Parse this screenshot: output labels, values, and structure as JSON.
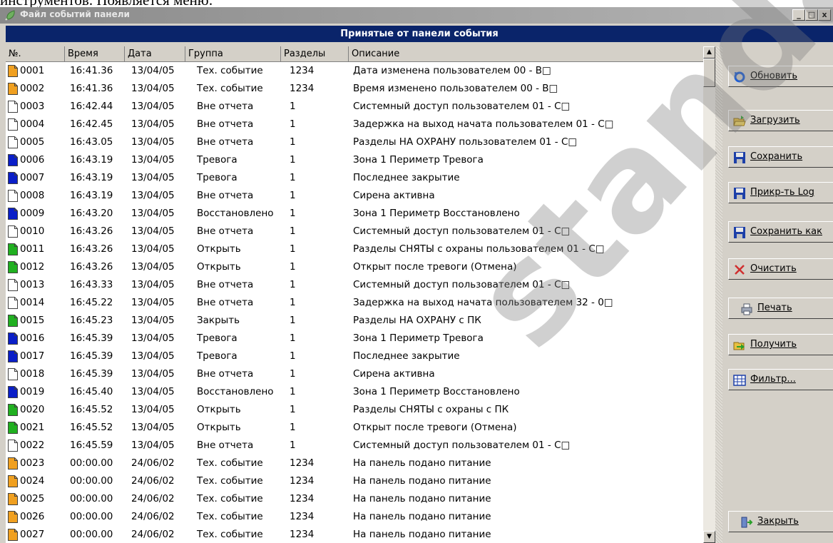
{
  "doc_caption": "инструментов. Появляется меню:",
  "window": {
    "title": "Файл событий панели",
    "minimize": "_",
    "maximize": "□",
    "close": "x"
  },
  "banner": "Принятые от панели события",
  "columns": [
    "№.",
    "Время",
    "Дата",
    "Группа",
    "Разделы",
    "Описание"
  ],
  "colors": {
    "orange": "#f0a020",
    "white": "#ffffff",
    "blue": "#0a1ec8",
    "green": "#20b020",
    "banner": "#0a246a"
  },
  "rows": [
    {
      "icon": "orange",
      "num": "0001",
      "time": "16:41.36",
      "date": "13/04/05",
      "group": "Тех. событие",
      "parts": "1234",
      "desc": "Дата изменена пользователем 00 - В□"
    },
    {
      "icon": "orange",
      "num": "0002",
      "time": "16:41.36",
      "date": "13/04/05",
      "group": "Тех. событие",
      "parts": "1234",
      "desc": "Время изменено пользователем 00 - В□"
    },
    {
      "icon": "white",
      "num": "0003",
      "time": "16:42.44",
      "date": "13/04/05",
      "group": "Вне отчета",
      "parts": "1",
      "desc": "Системный доступ пользователем 01 - С□"
    },
    {
      "icon": "white",
      "num": "0004",
      "time": "16:42.45",
      "date": "13/04/05",
      "group": "Вне отчета",
      "parts": "1",
      "desc": "Задержка на выход начата пользователем 01 - С□"
    },
    {
      "icon": "white",
      "num": "0005",
      "time": "16:43.05",
      "date": "13/04/05",
      "group": "Вне отчета",
      "parts": "1",
      "desc": "Разделы НА ОХРАНУ пользователем 01 - С□"
    },
    {
      "icon": "blue",
      "num": "0006",
      "time": "16:43.19",
      "date": "13/04/05",
      "group": "Тревога",
      "parts": "1",
      "desc": "Зона 1 Периметр Тревога"
    },
    {
      "icon": "blue",
      "num": "0007",
      "time": "16:43.19",
      "date": "13/04/05",
      "group": "Тревога",
      "parts": "1",
      "desc": "Последнее закрытие"
    },
    {
      "icon": "white",
      "num": "0008",
      "time": "16:43.19",
      "date": "13/04/05",
      "group": "Вне отчета",
      "parts": "1",
      "desc": "Сирена активна"
    },
    {
      "icon": "blue",
      "num": "0009",
      "time": "16:43.20",
      "date": "13/04/05",
      "group": "Восстановлено",
      "parts": "1",
      "desc": "Зона 1 Периметр Восстановлено"
    },
    {
      "icon": "white",
      "num": "0010",
      "time": "16:43.26",
      "date": "13/04/05",
      "group": "Вне отчета",
      "parts": "1",
      "desc": "Системный доступ пользователем 01 - С□"
    },
    {
      "icon": "green",
      "num": "0011",
      "time": "16:43.26",
      "date": "13/04/05",
      "group": "Открыть",
      "parts": "1",
      "desc": "Разделы СНЯТЫ с охраны пользователем 01 - С□"
    },
    {
      "icon": "green",
      "num": "0012",
      "time": "16:43.26",
      "date": "13/04/05",
      "group": "Открыть",
      "parts": "1",
      "desc": "Открыт после тревоги (Отмена)"
    },
    {
      "icon": "white",
      "num": "0013",
      "time": "16:43.33",
      "date": "13/04/05",
      "group": "Вне отчета",
      "parts": "1",
      "desc": "Системный доступ пользователем 01 - С□"
    },
    {
      "icon": "white",
      "num": "0014",
      "time": "16:45.22",
      "date": "13/04/05",
      "group": "Вне отчета",
      "parts": "1",
      "desc": "Задержка на выход начата пользователем 32 - 0□"
    },
    {
      "icon": "green",
      "num": "0015",
      "time": "16:45.23",
      "date": "13/04/05",
      "group": "Закрыть",
      "parts": "1",
      "desc": "Разделы НА ОХРАНУ с ПК"
    },
    {
      "icon": "blue",
      "num": "0016",
      "time": "16:45.39",
      "date": "13/04/05",
      "group": "Тревога",
      "parts": "1",
      "desc": "Зона 1 Периметр Тревога"
    },
    {
      "icon": "blue",
      "num": "0017",
      "time": "16:45.39",
      "date": "13/04/05",
      "group": "Тревога",
      "parts": "1",
      "desc": "Последнее закрытие"
    },
    {
      "icon": "white",
      "num": "0018",
      "time": "16:45.39",
      "date": "13/04/05",
      "group": "Вне отчета",
      "parts": "1",
      "desc": "Сирена активна"
    },
    {
      "icon": "blue",
      "num": "0019",
      "time": "16:45.40",
      "date": "13/04/05",
      "group": "Восстановлено",
      "parts": "1",
      "desc": "Зона 1 Периметр Восстановлено"
    },
    {
      "icon": "green",
      "num": "0020",
      "time": "16:45.52",
      "date": "13/04/05",
      "group": "Открыть",
      "parts": "1",
      "desc": "Разделы СНЯТЫ с охраны с ПК"
    },
    {
      "icon": "green",
      "num": "0021",
      "time": "16:45.52",
      "date": "13/04/05",
      "group": "Открыть",
      "parts": "1",
      "desc": "Открыт после тревоги (Отмена)"
    },
    {
      "icon": "white",
      "num": "0022",
      "time": "16:45.59",
      "date": "13/04/05",
      "group": "Вне отчета",
      "parts": "1",
      "desc": "Системный доступ пользователем 01 - С□"
    },
    {
      "icon": "orange",
      "num": "0023",
      "time": "00:00.00",
      "date": "24/06/02",
      "group": "Тех. событие",
      "parts": "1234",
      "desc": "На панель подано питание"
    },
    {
      "icon": "orange",
      "num": "0024",
      "time": "00:00.00",
      "date": "24/06/02",
      "group": "Тех. событие",
      "parts": "1234",
      "desc": "На панель подано питание"
    },
    {
      "icon": "orange",
      "num": "0025",
      "time": "00:00.00",
      "date": "24/06/02",
      "group": "Тех. событие",
      "parts": "1234",
      "desc": "На панель подано питание"
    },
    {
      "icon": "orange",
      "num": "0026",
      "time": "00:00.00",
      "date": "24/06/02",
      "group": "Тех. событие",
      "parts": "1234",
      "desc": "На панель подано питание"
    },
    {
      "icon": "orange",
      "num": "0027",
      "time": "00:00.00",
      "date": "24/06/02",
      "group": "Тех. событие",
      "parts": "1234",
      "desc": "На панель подано питание"
    }
  ],
  "buttons": [
    {
      "name": "refresh-button",
      "icon": "refresh-icon",
      "label": "Обновить"
    },
    {
      "name": "load-button",
      "icon": "folder-open-icon",
      "label": "Загрузить"
    },
    {
      "name": "save-button",
      "icon": "floppy-disk-icon",
      "label": "Сохранить"
    },
    {
      "name": "attach-log-button",
      "icon": "floppy-disk-icon",
      "label": "Прикр-ть Log"
    },
    {
      "name": "save-as-button",
      "icon": "floppy-disk-icon",
      "label": "Сохранить как"
    },
    {
      "name": "clear-button",
      "icon": "red-x-icon",
      "label": "Очистить"
    },
    {
      "name": "print-button",
      "icon": "printer-icon",
      "label": "Печать"
    },
    {
      "name": "receive-button",
      "icon": "receive-icon",
      "label": "Получить"
    },
    {
      "name": "filter-button",
      "icon": "filter-grid-icon",
      "label": "Фильтр..."
    },
    {
      "name": "close-button",
      "icon": "exit-door-icon",
      "label": "Закрыть"
    }
  ],
  "watermark": "standart"
}
